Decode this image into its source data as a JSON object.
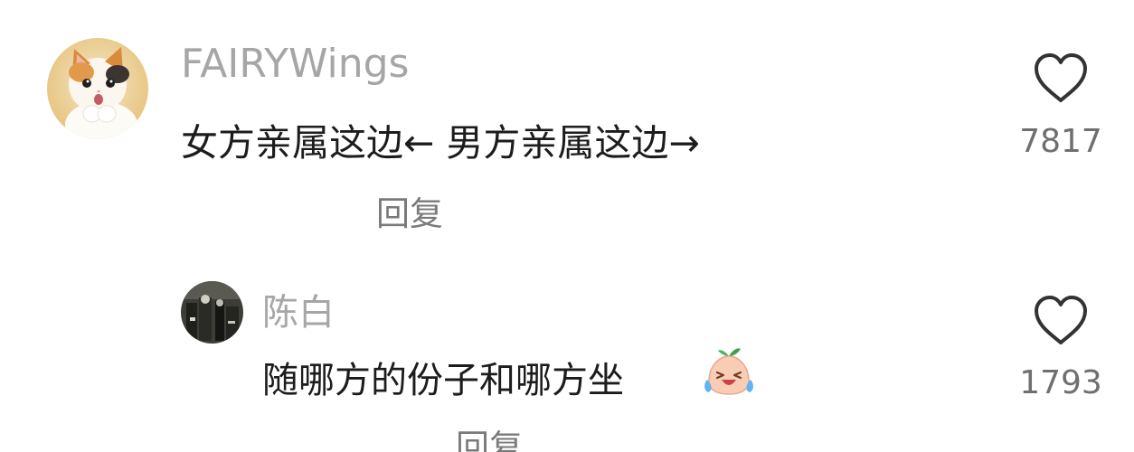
{
  "comments": [
    {
      "username": "FAIRYWings",
      "text": "女方亲属这边←  男方亲属这边→",
      "reply_label": "回复",
      "like_icon": "heart-outline-icon",
      "like_count": "7817",
      "avatar": "kitten-avatar"
    },
    {
      "username": "陈白",
      "text": "随哪方的份子和哪方坐",
      "emoji": "laughing-crying-emoji-icon",
      "reply_label": "回复",
      "like_icon": "heart-outline-icon",
      "like_count": "1793",
      "avatar": "photo-avatar"
    }
  ],
  "colors": {
    "username": "#a6a6a6",
    "text": "#1c1c1c",
    "reply": "#7a7a7a",
    "count": "#6f6f6f",
    "icon_stroke": "#333333"
  }
}
